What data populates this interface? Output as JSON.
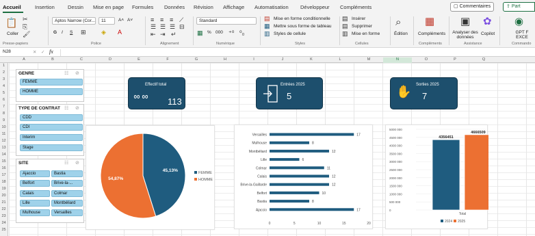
{
  "tabs": [
    "Accueil",
    "Insertion",
    "Dessin",
    "Mise en page",
    "Formules",
    "Données",
    "Révision",
    "Affichage",
    "Automatisation",
    "Développeur",
    "Compléments"
  ],
  "top_buttons": {
    "comments": "Commentaires",
    "share": "Part"
  },
  "ribbon": {
    "paste": "Coller",
    "font_name": "Aptos Narrow (Cor...",
    "font_size": "11",
    "font_grow": "A˄",
    "font_shrink": "A˅",
    "bold": "G",
    "italic": "I",
    "underline": "S",
    "number_format": "Standard",
    "number_percent": "%",
    "number_thousands": "000",
    "cond_format": "Mise en forme conditionnelle",
    "table_format": "Mettre sous forme de tableau",
    "cell_styles": "Styles de cellule",
    "insert": "Insérer",
    "delete": "Supprimer",
    "format": "Mise en forme",
    "edit": "Édition",
    "addins": "Compléments",
    "analyze": "Analyser des données",
    "copilot": "Copilot",
    "gpt": "GPT F EXCE",
    "groups": [
      "Presse-papiers",
      "Police",
      "Alignement",
      "Numérique",
      "Styles",
      "Cellules",
      "Compléments",
      "Assistance",
      "Commando"
    ]
  },
  "formula_bar": {
    "cell_ref": "N28",
    "fx": "fx",
    "value": ""
  },
  "columns": [
    "A",
    "B",
    "C",
    "D",
    "E",
    "F",
    "G",
    "H",
    "I",
    "J",
    "K",
    "L",
    "M",
    "N",
    "O",
    "P",
    "Q"
  ],
  "rows": [
    "1",
    "2",
    "3",
    "4",
    "5",
    "6",
    "7",
    "8",
    "9",
    "10",
    "11",
    "12",
    "13",
    "14",
    "15",
    "16",
    "17",
    "18",
    "19",
    "20",
    "21",
    "22",
    "23",
    "24",
    "25"
  ],
  "slicers": {
    "genre": {
      "title": "GENRE",
      "items": [
        "FEMME",
        "HOMME"
      ]
    },
    "contrat": {
      "title": "TYPE DE CONTRAT",
      "items": [
        "CDD",
        "CDI",
        "Interim",
        "Stage"
      ]
    },
    "site": {
      "title": "SITE",
      "items": [
        "Ajaccio",
        "Bastia",
        "Belfort",
        "Brive-la-...",
        "Calais",
        "Colmar",
        "Lille",
        "Montbéliard",
        "Mulhouse",
        "Versailles"
      ]
    }
  },
  "kpis": [
    {
      "label": "Effectif total",
      "value": "113",
      "icon": "people-group-icon"
    },
    {
      "label": "Entrées 2025",
      "value": "5",
      "icon": "entry-door-icon"
    },
    {
      "label": "Sorties 2025",
      "value": "7",
      "icon": "waving-hand-icon"
    }
  ],
  "chart_data": [
    {
      "type": "pie",
      "labels": [
        "FEMME",
        "HOMME"
      ],
      "values": [
        45.13,
        54.87
      ],
      "data_labels": [
        "45,13%",
        "54,87%"
      ],
      "colors": [
        "#1f5c7f",
        "#ec7032"
      ],
      "legend": "right"
    },
    {
      "type": "bar",
      "orientation": "horizontal",
      "categories": [
        "Versailles",
        "Mulhouse",
        "Montbéliard",
        "Lille",
        "Colmar",
        "Calais",
        "Brive-la-Gaillarde",
        "Belfort",
        "Bastia",
        "Ajaccio"
      ],
      "values": [
        17,
        8,
        12,
        6,
        11,
        12,
        12,
        10,
        8,
        17
      ],
      "xlim": [
        0,
        20
      ],
      "xticks": [
        "0",
        "5",
        "10",
        "15",
        "20"
      ],
      "color": "#1f5c7f"
    },
    {
      "type": "bar",
      "categories": [
        "Total"
      ],
      "series": [
        {
          "name": "2024",
          "values": [
            4356451
          ],
          "label": "4356451",
          "color": "#1f5c7f"
        },
        {
          "name": "2025",
          "values": [
            4666509
          ],
          "label": "4666509",
          "color": "#ec7032"
        }
      ],
      "ylim": [
        0,
        5000000
      ],
      "yticks": [
        "0",
        "500 000",
        "1000 000",
        "1500 000",
        "2000 000",
        "2500 000",
        "3000 000",
        "3500 000",
        "4000 000",
        "4500 000",
        "5000 000"
      ],
      "legend": "bottom"
    }
  ]
}
